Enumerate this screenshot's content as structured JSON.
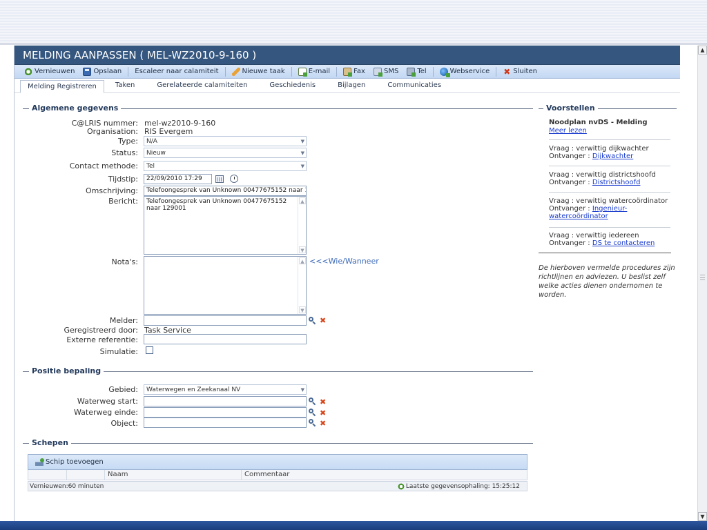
{
  "window": {
    "title": "MELDING AANPASSEN ( MEL-WZ2010-9-160 )"
  },
  "toolbar": {
    "refresh": "Vernieuwen",
    "save": "Opslaan",
    "escalate": "Escaleer naar calamiteit",
    "new_task": "Nieuwe taak",
    "email": "E-mail",
    "fax": "Fax",
    "sms": "SMS",
    "tel": "Tel",
    "webservice": "Webservice",
    "close": "Sluiten"
  },
  "tabs": [
    {
      "label": "Melding Registreren",
      "active": true
    },
    {
      "label": "Taken"
    },
    {
      "label": "Gerelateerde calamiteiten"
    },
    {
      "label": "Geschiedenis"
    },
    {
      "label": "Bijlagen"
    },
    {
      "label": "Communicaties"
    }
  ],
  "general": {
    "legend": "Algemene gegevens",
    "calris_label": "C@LRIS nummer:",
    "calris_value": "mel-wz2010-9-160",
    "org_label": "Organisation:",
    "org_value": "RIS Evergem",
    "type_label": "Type:",
    "type_value": "N/A",
    "status_label": "Status:",
    "status_value": "Nieuw",
    "contact_label": "Contact methode:",
    "contact_value": "Tel",
    "time_label": "Tijdstip:",
    "time_value": "22/09/2010 17:29",
    "desc_label": "Omschrijving:",
    "desc_value": "Telefoongesprek van Unknown 00477675152 naar  129001",
    "message_label": "Bericht:",
    "message_value": "Telefoongesprek van Unknown 00477675152 naar 129001",
    "notes_label": "Nota's:",
    "notes_value": "",
    "who_when_link": "<<<Wie/Wanneer",
    "reporter_label": "Melder:",
    "reporter_value": "",
    "registered_label": "Geregistreerd door:",
    "registered_value": "Task Service",
    "extref_label": "Externe referentie:",
    "extref_value": "",
    "sim_label": "Simulatie:"
  },
  "position": {
    "legend": "Positie bepaling",
    "area_label": "Gebied:",
    "area_value": "Waterwegen en Zeekanaal NV",
    "start_label": "Waterweg start:",
    "start_value": "",
    "end_label": "Waterweg einde:",
    "end_value": "",
    "object_label": "Object:",
    "object_value": ""
  },
  "ships": {
    "legend": "Schepen",
    "add_label": "Schip toevoegen",
    "col_name": "Naam",
    "col_comment": "Commentaar",
    "refresh_info": "Vernieuwen:60 minuten",
    "last_fetch": "Laatste gegevensophaling: 15:25:12"
  },
  "proposals": {
    "legend": "Voorstellen",
    "plan_title": "Noodplan nvDS - Melding",
    "read_more": "Meer lezen",
    "items": [
      {
        "question": "Vraag : verwittig dijkwachter",
        "receiver_label": "Ontvanger :",
        "receiver": "Dijkwachter"
      },
      {
        "question": "Vraag : verwittig districtshoofd",
        "receiver_label": "Ontvanger :",
        "receiver": "Districtshoofd"
      },
      {
        "question": "Vraag : verwittig watercoördinator",
        "receiver_label": "Ontvanger :",
        "receiver_a": "Ingenieur-",
        "receiver_b": "watercoördinator"
      },
      {
        "question": "Vraag : verwittig iedereen",
        "receiver_label": "Ontvanger :",
        "receiver": "DS te contacteren"
      }
    ],
    "note": "De hierboven vermelde procedures zijn richtlijnen en adviezen. U beslist zelf welke acties dienen ondernomen te worden."
  }
}
